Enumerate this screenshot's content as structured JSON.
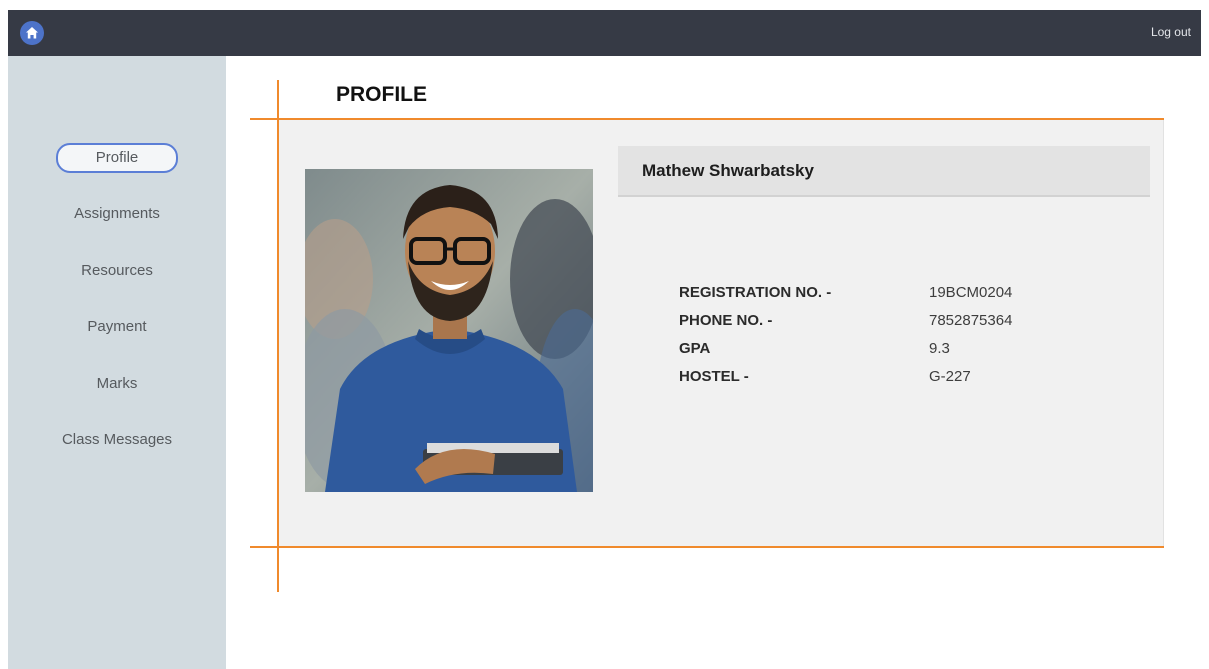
{
  "header": {
    "logout_label": "Log out"
  },
  "sidebar": {
    "items": [
      {
        "label": "Profile",
        "active": true
      },
      {
        "label": "Assignments"
      },
      {
        "label": "Resources"
      },
      {
        "label": "Payment"
      },
      {
        "label": "Marks"
      },
      {
        "label": "Class Messages"
      }
    ]
  },
  "page": {
    "title": "PROFILE"
  },
  "profile": {
    "name": "Mathew Shwarbatsky",
    "fields": [
      {
        "label": "REGISTRATION NO. -",
        "value": "19BCM0204"
      },
      {
        "label": "PHONE NO. -",
        "value": "7852875364"
      },
      {
        "label": "GPA",
        "value": "9.3"
      },
      {
        "label": "HOSTEL -",
        "value": "G-227"
      }
    ]
  },
  "colors": {
    "topbar": "#363a45",
    "sidebar": "#d2dbe0",
    "accent_orange": "#f08a2c",
    "active_outline": "#5b7ed6",
    "home_icon_bg": "#4d73c9"
  }
}
